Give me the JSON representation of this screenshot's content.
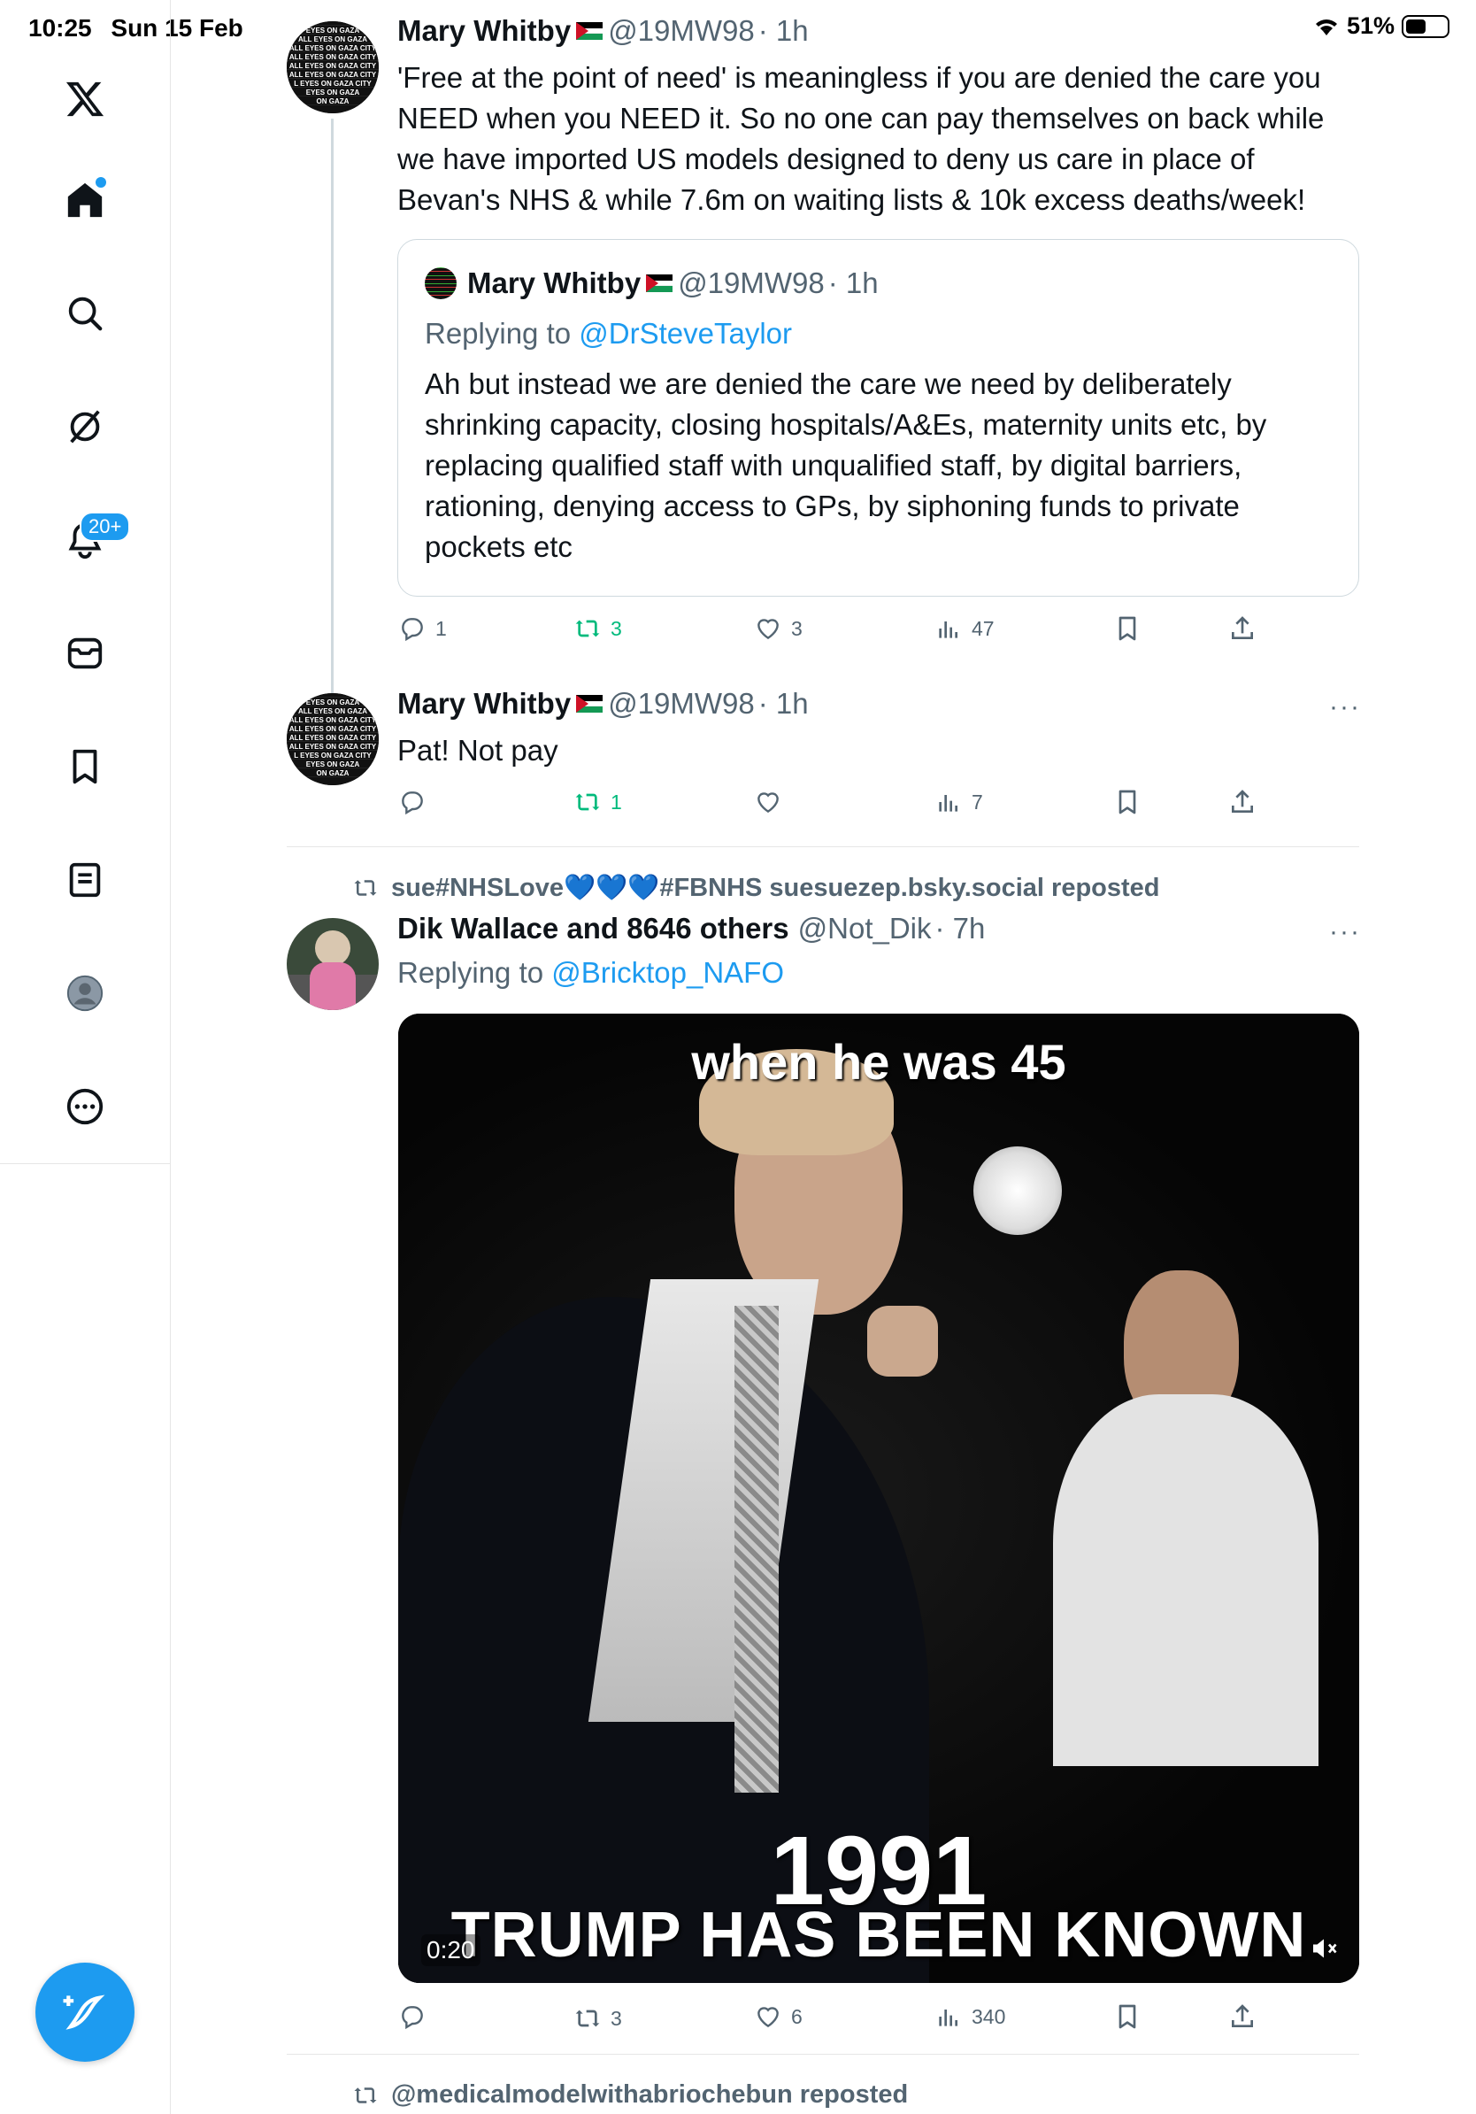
{
  "status_bar": {
    "time": "10:25",
    "date": "Sun 15 Feb",
    "battery": "51%"
  },
  "sidebar": {
    "items": [
      {
        "icon": "x-logo-icon"
      },
      {
        "icon": "home-icon"
      },
      {
        "icon": "search-icon"
      },
      {
        "icon": "grok-icon"
      },
      {
        "icon": "notifications-icon",
        "badge": "20+"
      },
      {
        "icon": "messages-icon"
      },
      {
        "icon": "bookmarks-icon"
      },
      {
        "icon": "lists-icon"
      },
      {
        "icon": "profile-icon"
      },
      {
        "icon": "more-icon"
      }
    ],
    "compose_icon": "compose-icon"
  },
  "tweets": [
    {
      "name": "Mary Whitby",
      "handle": "@19MW98",
      "time": "· 1h",
      "text": "'Free at the point of need'  is meaningless if you are denied the care you NEED when you NEED it. So no one can pay themselves on back while we have imported US models designed to deny us care in place of Bevan's NHS & while 7.6m on waiting lists & 10k excess deaths/week!",
      "quote": {
        "name": "Mary Whitby",
        "handle": "@19MW98",
        "time": "· 1h",
        "replying_prefix": "Replying to ",
        "replying_to": "@DrSteveTaylor",
        "text": "Ah but instead we are denied the care we need by deliberately shrinking capacity, closing hospitals/A&Es, maternity units etc, by replacing qualified staff with unqualified staff, by digital barriers, rationing, denying access to GPs, by siphoning funds to private pockets etc"
      },
      "replies": "1",
      "reposts": "3",
      "likes": "3",
      "views": "47"
    },
    {
      "name": "Mary Whitby",
      "handle": "@19MW98",
      "time": "· 1h",
      "text": "Pat! Not pay",
      "replies": "",
      "reposts": "1",
      "likes": "",
      "views": "7"
    },
    {
      "reposted_by": "sue#NHSLove💙💙💙#FBNHS suesuezep.bsky.social reposted",
      "name": "Dik Wallace and 8646 others",
      "handle": "@Not_Dik",
      "time": "· 7h",
      "replying_prefix": "Replying to ",
      "replying_to": "@Bricktop_NAFO",
      "video": {
        "caption_top": "when he was 45",
        "year": "1991",
        "caption_bottom": "TRUMP HAS BEEN KNOWN",
        "duration": "0:20"
      },
      "replies": "",
      "reposts": "3",
      "likes": "6",
      "views": "340"
    }
  ],
  "next_repost": "@medicalmodelwithabriochebun reposted",
  "colors": {
    "accent": "#1d9bf0",
    "repost_green": "#00ba7c",
    "muted": "#536471"
  }
}
